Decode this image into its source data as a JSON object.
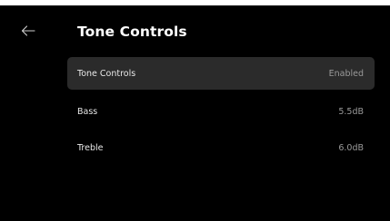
{
  "header": {
    "back_icon": "arrow-left-icon",
    "title": "Tone Controls"
  },
  "settings": [
    {
      "label": "Tone Controls",
      "value": "Enabled",
      "focused": true
    },
    {
      "label": "Bass",
      "value": "5.5dB",
      "focused": false
    },
    {
      "label": "Treble",
      "value": "6.0dB",
      "focused": false
    }
  ],
  "colors": {
    "background": "#000000",
    "focused_row": "#2b2b2b",
    "label_text": "#e8e8e8",
    "value_text": "#9a9a9a"
  }
}
